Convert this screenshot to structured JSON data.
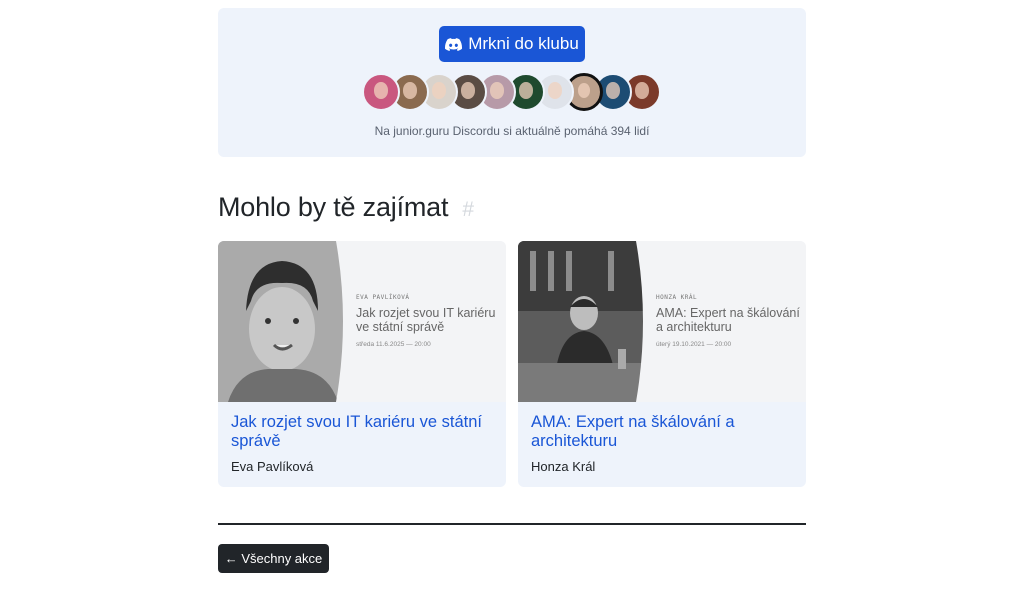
{
  "club": {
    "button_label": "Mrkni do klubu",
    "button_icon": "discord-icon",
    "note": "Na junior.guru Discordu si aktuálně pomáhá 394 lidí",
    "avatars": [
      {
        "name": "avatar-1",
        "color": "#c9577f"
      },
      {
        "name": "avatar-2",
        "color": "#8a6a4f"
      },
      {
        "name": "avatar-3",
        "color": "#d9d3cc"
      },
      {
        "name": "avatar-4",
        "color": "#5a4c44"
      },
      {
        "name": "avatar-5",
        "color": "#b79aa8"
      },
      {
        "name": "avatar-6",
        "color": "#1f4a2e"
      },
      {
        "name": "avatar-7",
        "color": "#dfe3ea"
      },
      {
        "name": "avatar-8",
        "color": "#bca08b"
      },
      {
        "name": "avatar-9",
        "color": "#1d4c73"
      },
      {
        "name": "avatar-10",
        "color": "#7b3a2a"
      }
    ]
  },
  "section": {
    "title": "Mohlo by tě zajímat",
    "anchor": "#"
  },
  "cards": [
    {
      "img_name": "Eva Pavlíková",
      "img_title": "Jak rozjet svou IT kariéru ve státní správě",
      "img_date": "středa 11.6.2025 — 20:00",
      "title": "Jak rozjet svou IT kariéru ve státní správě",
      "author": "Eva Pavlíková"
    },
    {
      "img_name": "Honza Král",
      "img_title": "AMA: Expert na škálování a architekturu",
      "img_date": "úterý 19.10.2021 — 20:00",
      "title": "AMA: Expert na škálování a architekturu",
      "author": "Honza Král"
    }
  ],
  "footer": {
    "back_label": "← Všechny akce"
  }
}
